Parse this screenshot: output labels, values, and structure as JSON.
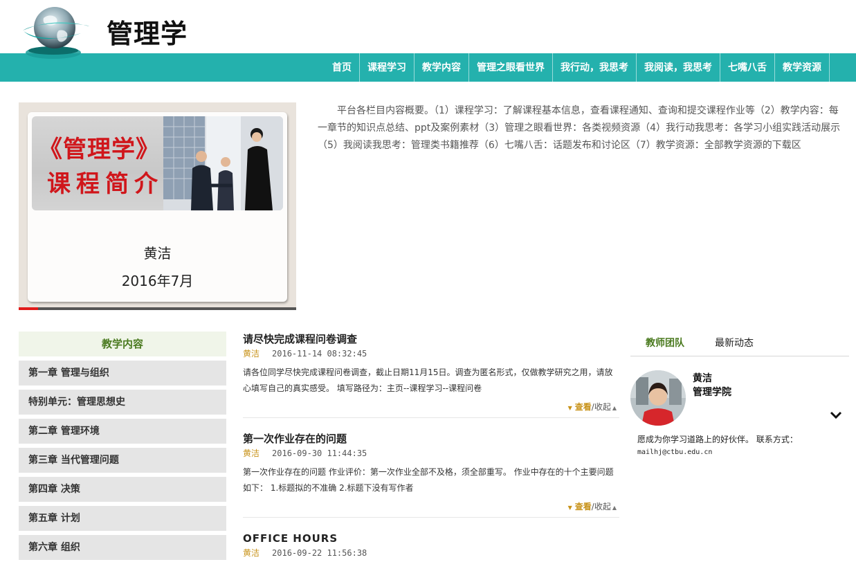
{
  "site": {
    "title": "管理学",
    "logo_icon": "globe-logo-icon"
  },
  "nav": {
    "items": [
      "首页",
      "课程学习",
      "教学内容",
      "管理之眼看世界",
      "我行动，我思考",
      "我阅读，我思考",
      "七嘴八舌",
      "教学资源"
    ],
    "bg_color": "#24b1ad"
  },
  "slide": {
    "banner_line1": "《管理学》",
    "banner_line2": "课程简介",
    "author": "黄洁",
    "date": "2016年7月",
    "progress": 0.07
  },
  "intro": "平台各栏目内容概要。（1）课程学习：了解课程基本信息，查看课程通知、查询和提交课程作业等（2）教学内容：每一章节的知识点总结、ppt及案例素材（3）管理之眼看世界：各类视频资源（4）我行动我思考：各学习小组实践活动展示（5）我阅读我思考：管理类书籍推荐（6）七嘴八舌：话题发布和讨论区（7）教学资源：全部教学资源的下载区",
  "sidebar": {
    "title": "教学内容",
    "items": [
      "第一章 管理与组织",
      "特别单元：管理思想史",
      "第二章 管理环境",
      "第三章 当代管理问题",
      "第四章 决策",
      "第五章 计划",
      "第六章 组织"
    ]
  },
  "posts": [
    {
      "title": "请尽快完成课程问卷调查",
      "author": "黄洁",
      "time": "2016-11-14 08:32:45",
      "body": "请各位同学尽快完成课程问卷调查，截止日期11月15日。调查为匿名形式，仅做教学研究之用，请放心填写自己的真实感受。 填写路径为：主页--课程学习--课程问卷",
      "toggle_view": "查看",
      "toggle_rest": "/收起"
    },
    {
      "title": "第一次作业存在的问题",
      "author": "黄洁",
      "time": "2016-09-30 11:44:35",
      "body": "第一次作业存在的问题 作业评价：第一次作业全部不及格，须全部重写。 作业中存在的十个主要问题如下： 1.标题拟的不准确 2.标题下没有写作者",
      "toggle_view": "查看",
      "toggle_rest": "/收起"
    },
    {
      "title": "OFFICE HOURS",
      "author": "黄洁",
      "time": "2016-09-22 11:56:38"
    }
  ],
  "team": {
    "tabs": [
      "教师团队",
      "最新动态"
    ],
    "name": "黄洁",
    "dept": "管理学院",
    "desc": "愿成为你学习道路上的好伙伴。 联系方式：",
    "email": "mailhj@ctbu.edu.cn"
  }
}
